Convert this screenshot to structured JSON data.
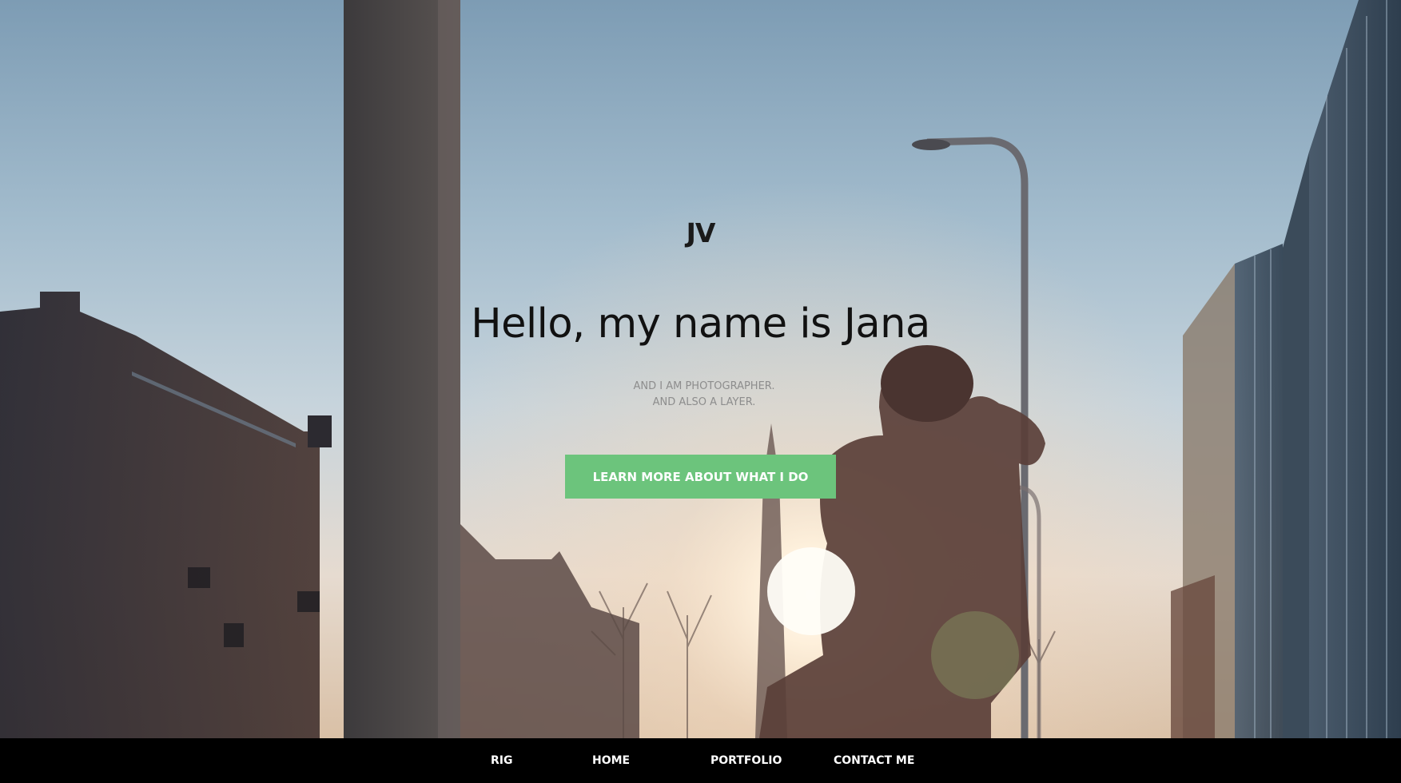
{
  "hero": {
    "logo": "JV",
    "headline": "Hello, my name is Jana",
    "subtitle_line1": "AND I AM PHOTOGRAPHER.",
    "subtitle_line2": "AND ALSO A LAYER.",
    "cta_label": "LEARN MORE ABOUT WHAT I DO",
    "background_image": "city-street-sunset-photographer-photo"
  },
  "nav": {
    "items": [
      {
        "label": "RIG"
      },
      {
        "label": "HOME"
      },
      {
        "label": "PORTFOLIO"
      },
      {
        "label": "CONTACT ME"
      }
    ]
  },
  "colors": {
    "cta_bg": "#6cc47c",
    "nav_bg": "#000000",
    "nav_text": "#ffffff",
    "headline": "#111111",
    "subtitle": "#8d8d8d"
  }
}
